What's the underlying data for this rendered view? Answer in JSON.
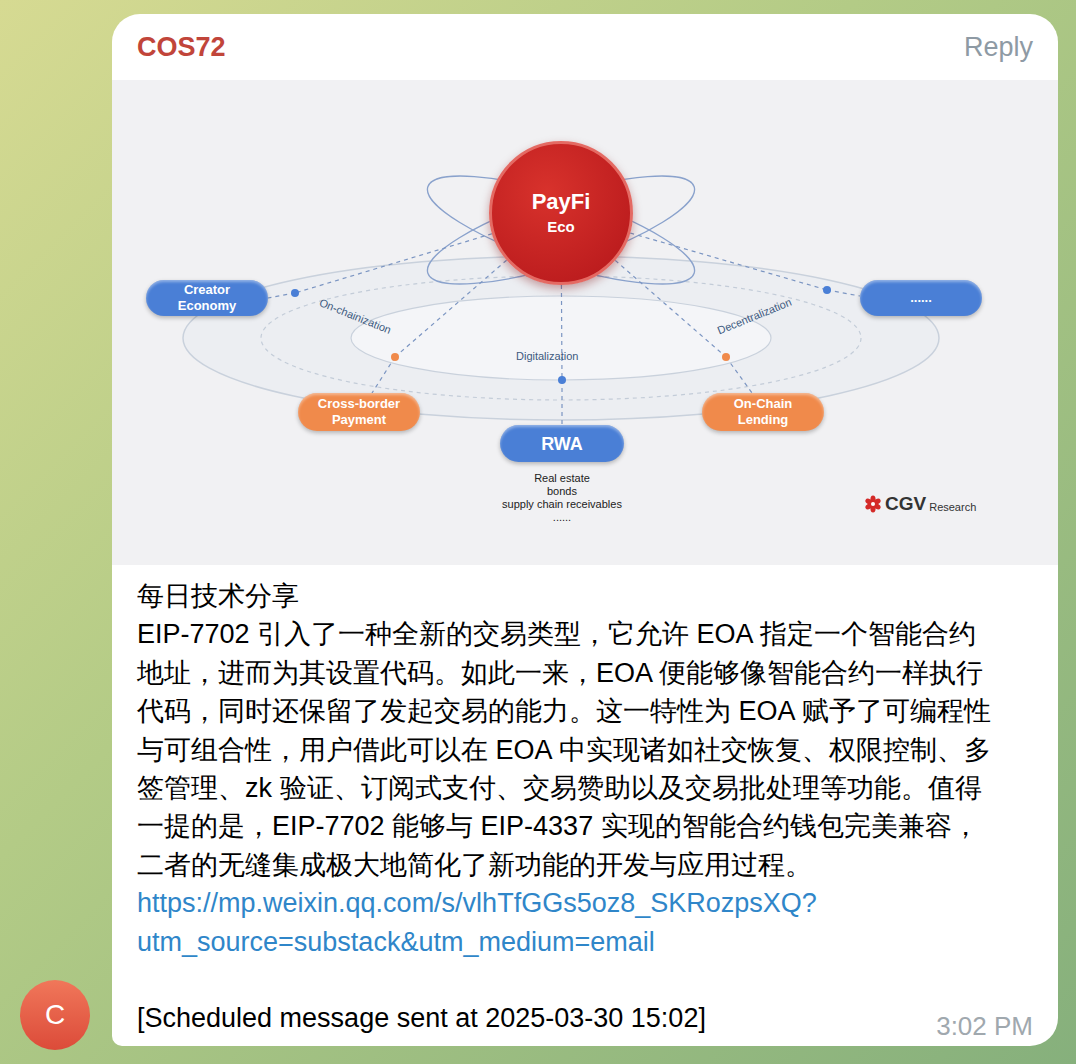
{
  "chat": {
    "sender": "COS72",
    "reply_label": "Reply",
    "avatar_letter": "C"
  },
  "image": {
    "center": {
      "title": "PayFi",
      "subtitle": "Eco"
    },
    "nodes": [
      {
        "label": "Creator Economy",
        "color": "#4a7fd6"
      },
      {
        "label": "......",
        "color": "#4a7fd6"
      },
      {
        "label": "Cross-border Payment",
        "color": "#f08a4b"
      },
      {
        "label": "RWA",
        "color": "#4a7fd6"
      },
      {
        "label": "On-Chain Lending",
        "color": "#f08a4b"
      }
    ],
    "axes": [
      "On-chainization",
      "Digitalization",
      "Decentralization"
    ],
    "rwa_examples": [
      "Real estate",
      "bonds",
      "supply chain receivables",
      "......"
    ],
    "logo": {
      "mark": "CGV",
      "text": "Research"
    }
  },
  "message": {
    "lines": [
      "每日技术分享",
      "EIP-7702 引入了一种全新的交易类型，它允许 EOA 指定一个智能合约",
      "地址，进而为其设置代码。如此一来，EOA 便能够像智能合约一样执行",
      "代码，同时还保留了发起交易的能力。这一特性为 EOA 赋予了可编程性",
      "与可组合性，用户借此可以在 EOA 中实现诸如社交恢复、权限控制、多",
      "签管理、zk 验证、订阅式支付、交易赞助以及交易批处理等功能。值得",
      "一提的是，EIP-7702 能够与 EIP-4337 实现的智能合约钱包完美兼容，",
      "二者的无缝集成极大地简化了新功能的开发与应用过程。"
    ],
    "link_lines": [
      "https://mp.weixin.qq.com/s/vlhTfGGs5oz8_SKRozpsXQ?",
      "utm_source=substack&utm_medium=email"
    ],
    "footer": "[Scheduled message sent at 2025-03-30 15:02]",
    "time": "3:02 PM"
  }
}
